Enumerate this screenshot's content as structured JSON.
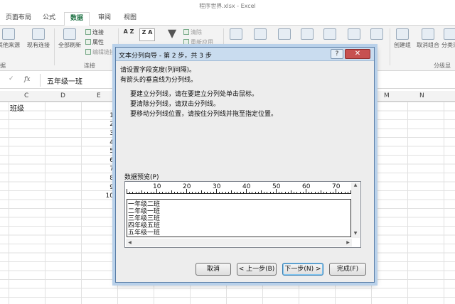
{
  "window": {
    "title": "程序世界.xlsx - Excel"
  },
  "tabs": [
    "页面布局",
    "公式",
    "数据",
    "审阅",
    "视图"
  ],
  "ribbon": {
    "from_source": "其他来源",
    "existing": "现有连接",
    "refresh_all": "全部刷新",
    "connections": "连接",
    "properties": "属性",
    "edit_links": "编辑链接",
    "group_connections": "连接",
    "group_get": "据",
    "clear": "清除",
    "reapply": "重新应用",
    "group_label": "创建组",
    "ungroup_label": "取消组合",
    "subtotal_label": "分类汇",
    "outline_group": "分级显",
    "sort_az": "A Z",
    "sort_za": "Z A"
  },
  "formula_bar": {
    "check": "✓",
    "fx": "fx",
    "value": "五年级一班"
  },
  "grid": {
    "columns": [
      "C",
      "D",
      "E",
      "M",
      "N"
    ],
    "cell_c2": "班级",
    "row_numbers": [
      "1",
      "2",
      "3",
      "4",
      "5",
      "6",
      "7",
      "8",
      "9",
      "10"
    ]
  },
  "dialog": {
    "title": "文本分列向导 - 第 2 步，共 3 步",
    "help": "?",
    "close": "✕",
    "instruction1": "请设置字段宽度(列间隔)。",
    "instruction2": "有箭头的垂直线为分列线。",
    "hint1": "要建立分列线，请在要建立分列处单击鼠标。",
    "hint2": "要清除分列线，请双击分列线。",
    "hint3": "要移动分列线位置，请按住分列线并拖至指定位置。",
    "preview_label": "数据预览(P)",
    "ruler": [
      "10",
      "20",
      "30",
      "40",
      "50",
      "60",
      "70"
    ],
    "rows": [
      "一年级二班",
      "二年级一班",
      "三年级三班",
      "四年级五班",
      "五年级一班"
    ],
    "buttons": {
      "cancel": "取消",
      "back": "< 上一步(B)",
      "next": "下一步(N) >",
      "finish": "完成(F)"
    }
  }
}
